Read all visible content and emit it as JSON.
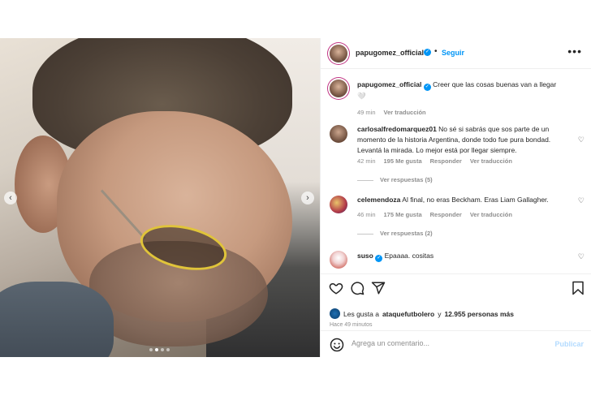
{
  "header": {
    "username": "papugomez_official",
    "separator": "•",
    "follow_label": "Seguir",
    "more_icon": "more-horizontal-icon"
  },
  "caption": {
    "username": "papugomez_official",
    "text": "Creer que las cosas buenas van a llegar",
    "emoji": "🤍",
    "time": "49 min",
    "translate_label": "Ver traducción"
  },
  "comments": [
    {
      "username": "carlosalfredomarquez01",
      "text": "No sé si sabrás que sos parte de un momento de la historia Argentina, donde todo fue pura bondad. Levantá la mirada. Lo mejor está por llegar siempre.",
      "time": "42 min",
      "likes": "195 Me gusta",
      "reply_label": "Responder",
      "translate_label": "Ver traducción",
      "replies_label": "Ver respuestas (5)"
    },
    {
      "username": "celemendoza",
      "text": "Al final, no eras Beckham. Eras Liam Gallagher.",
      "time": "46 min",
      "likes": "175 Me gusta",
      "reply_label": "Responder",
      "translate_label": "Ver traducción",
      "replies_label": "Ver respuestas (2)"
    },
    {
      "username": "suso",
      "text": "Epaaaa. cositas",
      "time": "",
      "likes": "",
      "reply_label": "",
      "translate_label": ""
    }
  ],
  "actions": {
    "like_icon": "heart-icon",
    "comment_icon": "comment-icon",
    "share_icon": "send-icon",
    "save_icon": "bookmark-icon"
  },
  "likes": {
    "prefix": "Les gusta a",
    "user": "ataquefutbolero",
    "connector": "y",
    "count": "12.955 personas más"
  },
  "post_time": "Hace 49 minutos",
  "add_comment": {
    "placeholder": "Agrega un comentario...",
    "publish_label": "Publicar"
  },
  "carousel": {
    "prev_label": "‹",
    "next_label": "›",
    "slides": 4,
    "active_slide": 2
  },
  "colors": {
    "accent": "#0095f6",
    "text": "#262626",
    "muted": "#8e8e8e",
    "glasses": "#e0c43a"
  }
}
